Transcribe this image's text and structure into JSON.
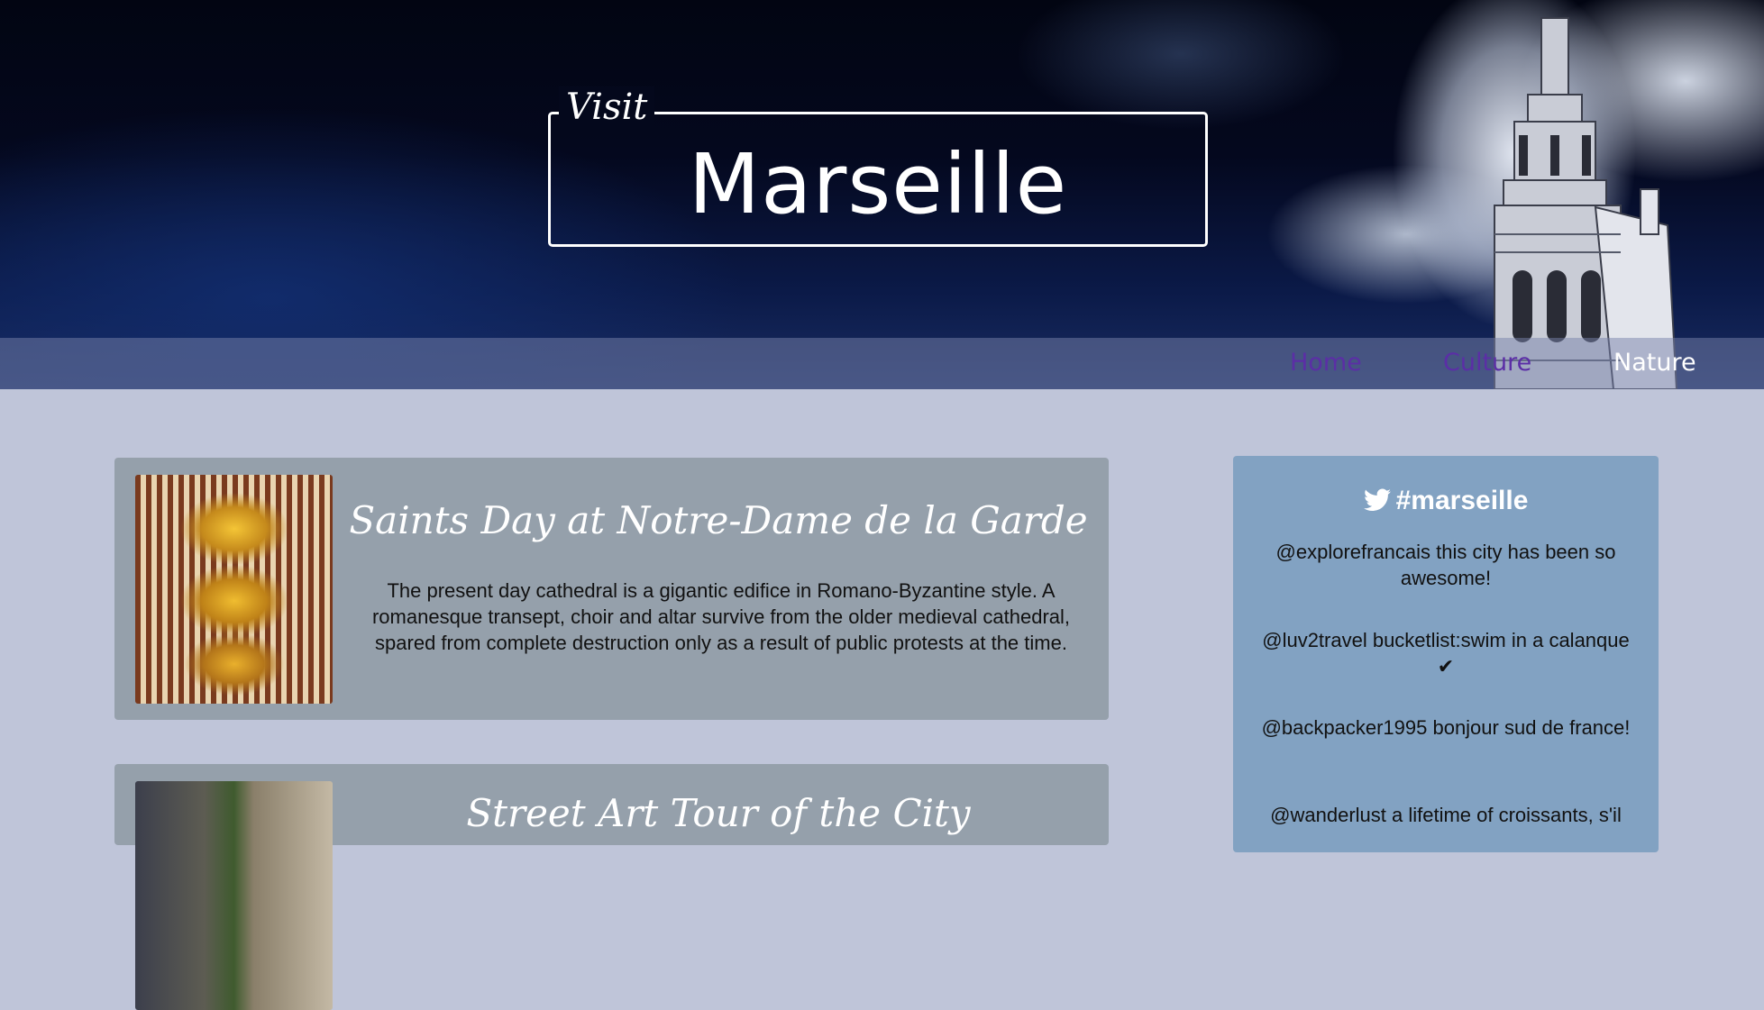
{
  "header": {
    "visit_label": "Visit",
    "city_title": "Marseille"
  },
  "nav": {
    "items": [
      {
        "label": "Home",
        "color": "#5b2ea6"
      },
      {
        "label": "Culture",
        "color": "#5b2ea6"
      },
      {
        "label": "Nature",
        "color": "#ffffff"
      }
    ]
  },
  "cards": [
    {
      "title": "Saints Day at Notre-Dame de la Garde",
      "text": "The present day cathedral is a gigantic edifice in Romano-Byzantine style. A romanesque transept, choir and altar survive from the older medieval cathedral, spared from complete destruction only as a result of public protests at the time.",
      "image": "cathedral-dome-image"
    },
    {
      "title": "Street Art Tour of the City",
      "image": "street-art-image"
    }
  ],
  "twitter": {
    "icon": "twitter-bird-icon",
    "hashtag": "#marseille",
    "tweets": [
      {
        "text": "@explorefrancais this city has been so awesome!"
      },
      {
        "text": "@luv2travel bucketlist:swim in a calanque ✔"
      },
      {
        "text": "@backpacker1995 bonjour sud de france!"
      },
      {
        "text": "@wanderlust a lifetime of croissants, s'il"
      }
    ]
  },
  "colors": {
    "page_bg": "#bfc5d9",
    "card_bg": "#95a0ab",
    "twitter_bg": "#82a2c2",
    "nav_link": "#5b2ea6"
  }
}
